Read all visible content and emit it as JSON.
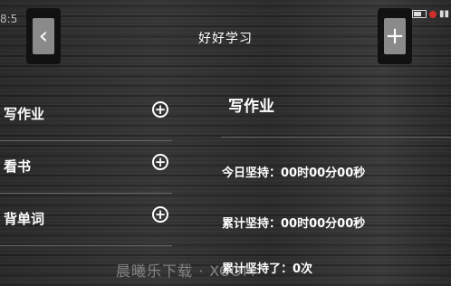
{
  "status_bar": {
    "time": "8:5"
  },
  "header": {
    "title": "好好学习",
    "back_glyph": "‹",
    "add_glyph": "+"
  },
  "tasks": [
    {
      "label": "写作业"
    },
    {
      "label": "看书"
    },
    {
      "label": "背单词"
    }
  ],
  "detail": {
    "title": "写作业",
    "today": "今日坚持：00时00分00秒",
    "total": "累计坚持：00时00分00秒",
    "count": "累计坚持了：0次"
  },
  "watermark": "晨曦乐下载 · XCOM"
}
